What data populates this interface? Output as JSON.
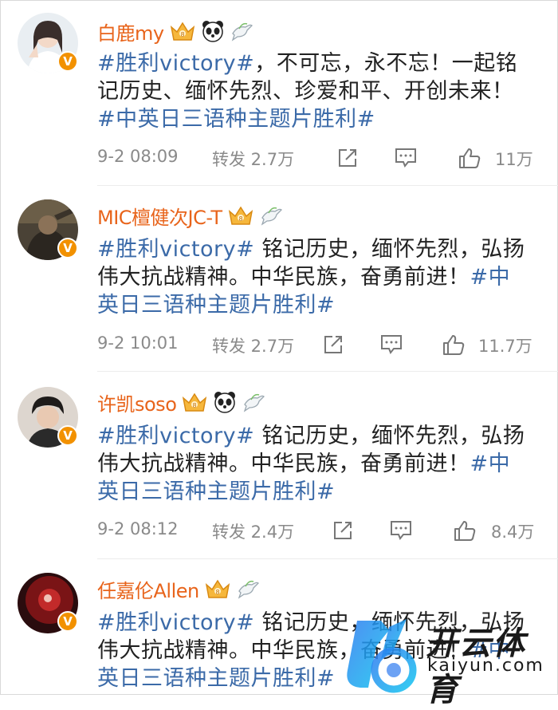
{
  "posts": [
    {
      "username": "白鹿my",
      "badges": [
        "crown-badge",
        "panda-icon",
        "dove-icon"
      ],
      "hashtag": "#胜利victory#",
      "text": "，不可忘，永不忘！一起铭记历史、缅怀先烈、珍爱和平、开创未来！",
      "hashtag2": "#中英日三语种主题片胜利#",
      "time": "9-2 08:09",
      "repost_label": "转发 2.7万",
      "likes": "11万"
    },
    {
      "username": "MIC檀健次JC-T",
      "badges": [
        "crown-badge",
        "dove-icon"
      ],
      "hashtag": "#胜利victory#",
      "text": " 铭记历史，缅怀先烈，弘扬伟大抗战精神。中华民族，奋勇前进！",
      "hashtag2": "#中英日三语种主题片胜利#",
      "time": "9-2 10:01",
      "repost_label": "转发 2.7万",
      "likes": "11.7万"
    },
    {
      "username": "许凯soso",
      "badges": [
        "crown-badge",
        "panda-icon",
        "dove-icon"
      ],
      "hashtag": "#胜利victory#",
      "text": " 铭记历史，缅怀先烈，弘扬伟大抗战精神。中华民族，奋勇前进！",
      "hashtag2": "#中英日三语种主题片胜利#",
      "time": "9-2 08:12",
      "repost_label": "转发 2.4万",
      "likes": "8.4万"
    },
    {
      "username": "任嘉伦Allen",
      "badges": [
        "crown-badge",
        "dove-icon"
      ],
      "hashtag": "#胜利victory#",
      "text": " 铭记历史，缅怀先烈，弘扬伟大抗战精神。中华民族，奋勇前进！",
      "hashtag2": "#中英日三语种主题片胜利#"
    }
  ],
  "verified_mark": "V",
  "watermark": {
    "cn": "开云体育",
    "en": "kaiyun.com"
  },
  "colors": {
    "username": "#e8641b",
    "hashtag": "#3b6aa8",
    "meta": "#8a8a8a",
    "verified": "#f29100"
  }
}
